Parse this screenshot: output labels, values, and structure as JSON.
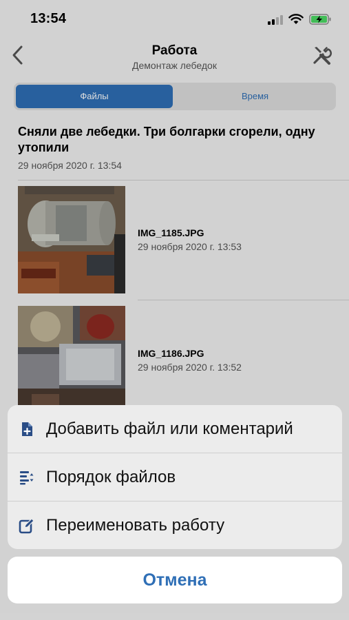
{
  "status": {
    "time": "13:54"
  },
  "nav": {
    "title": "Работа",
    "subtitle": "Демонтаж лебедок"
  },
  "tabs": {
    "files": "Файлы",
    "time": "Время"
  },
  "note": {
    "text": "Сняли две лебедки. Три болгарки сгорели, одну утопили",
    "date": "29 ноября 2020 г. 13:54"
  },
  "files": [
    {
      "name": "IMG_1185.JPG",
      "date": "29 ноября 2020 г. 13:53"
    },
    {
      "name": "IMG_1186.JPG",
      "date": "29 ноября 2020 г. 13:52"
    }
  ],
  "actions": [
    {
      "label": "Добавить файл или коментарий",
      "icon": "add-file-icon"
    },
    {
      "label": "Порядок файлов",
      "icon": "sort-order-icon"
    },
    {
      "label": "Переименовать работу",
      "icon": "edit-icon"
    }
  ],
  "cancel_label": "Отмена",
  "colors": {
    "accent": "#2f6fb6",
    "battery": "#4cd964"
  }
}
